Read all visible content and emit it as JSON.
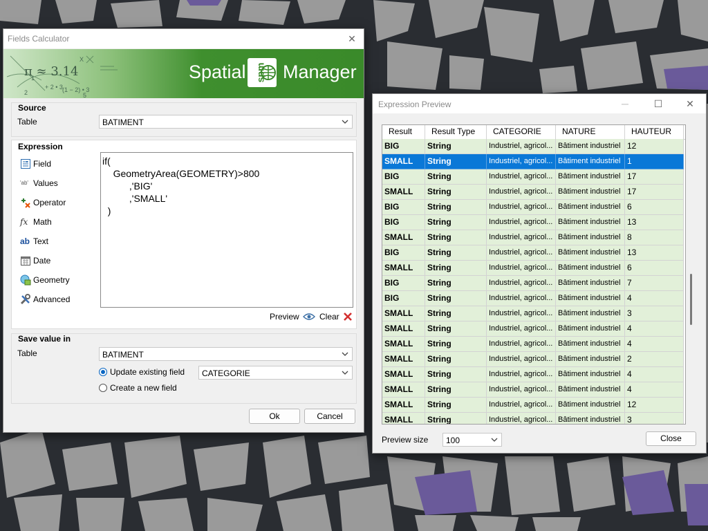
{
  "colors": {
    "accent": "#0a78d7",
    "row_green": "#e2f0d9",
    "banner_green": "#3f8f2e",
    "map_bg": "#2a2d32",
    "building_gray": "#9a9a9a",
    "building_purple": "#6a5a9a"
  },
  "fields_calculator": {
    "title": "Fields Calculator",
    "banner": {
      "formula": "π ≈ 3.14",
      "brand_left": "Spatial",
      "brand_badge": "spm",
      "brand_right": "Manager"
    },
    "source": {
      "title": "Source",
      "table_label": "Table",
      "table_value": "BATIMENT"
    },
    "expression": {
      "title": "Expression",
      "categories": [
        {
          "label": "Field",
          "icon": "field-icon"
        },
        {
          "label": "Values",
          "icon": "values-icon",
          "badge": "'ab'"
        },
        {
          "label": "Operator",
          "icon": "operator-icon"
        },
        {
          "label": "Math",
          "icon": "math-icon",
          "badge": "fx"
        },
        {
          "label": "Text",
          "icon": "text-icon",
          "badge": "ab"
        },
        {
          "label": "Date",
          "icon": "date-icon"
        },
        {
          "label": "Geometry",
          "icon": "geometry-icon"
        },
        {
          "label": "Advanced",
          "icon": "advanced-icon"
        }
      ],
      "code": "if(\n    GeometryArea(GEOMETRY)>800\n          ,'BIG'\n          ,'SMALL'\n  )",
      "preview_label": "Preview",
      "clear_label": "Clear"
    },
    "save": {
      "title": "Save value in",
      "table_label": "Table",
      "table_value": "BATIMENT",
      "update_label": "Update existing field",
      "update_field_value": "CATEGORIE",
      "create_label": "Create a new field",
      "selected_option": "update"
    },
    "ok_label": "Ok",
    "cancel_label": "Cancel"
  },
  "expression_preview": {
    "title": "Expression Preview",
    "columns": [
      "Result",
      "Result Type",
      "CATEGORIE",
      "NATURE",
      "HAUTEUR"
    ],
    "rows": [
      [
        "BIG",
        "String",
        "Industriel, agricol...",
        "Bâtiment industriel",
        "12"
      ],
      [
        "SMALL",
        "String",
        "Industriel, agricol...",
        "Bâtiment industriel",
        "1"
      ],
      [
        "BIG",
        "String",
        "Industriel, agricol...",
        "Bâtiment industriel",
        "17"
      ],
      [
        "SMALL",
        "String",
        "Industriel, agricol...",
        "Bâtiment industriel",
        "17"
      ],
      [
        "BIG",
        "String",
        "Industriel, agricol...",
        "Bâtiment industriel",
        "6"
      ],
      [
        "BIG",
        "String",
        "Industriel, agricol...",
        "Bâtiment industriel",
        "13"
      ],
      [
        "SMALL",
        "String",
        "Industriel, agricol...",
        "Bâtiment industriel",
        "8"
      ],
      [
        "BIG",
        "String",
        "Industriel, agricol...",
        "Bâtiment industriel",
        "13"
      ],
      [
        "SMALL",
        "String",
        "Industriel, agricol...",
        "Bâtiment industriel",
        "6"
      ],
      [
        "BIG",
        "String",
        "Industriel, agricol...",
        "Bâtiment industriel",
        "7"
      ],
      [
        "BIG",
        "String",
        "Industriel, agricol...",
        "Bâtiment industriel",
        "4"
      ],
      [
        "SMALL",
        "String",
        "Industriel, agricol...",
        "Bâtiment industriel",
        "3"
      ],
      [
        "SMALL",
        "String",
        "Industriel, agricol...",
        "Bâtiment industriel",
        "4"
      ],
      [
        "SMALL",
        "String",
        "Industriel, agricol...",
        "Bâtiment industriel",
        "4"
      ],
      [
        "SMALL",
        "String",
        "Industriel, agricol...",
        "Bâtiment industriel",
        "2"
      ],
      [
        "SMALL",
        "String",
        "Industriel, agricol...",
        "Bâtiment industriel",
        "4"
      ],
      [
        "SMALL",
        "String",
        "Industriel, agricol...",
        "Bâtiment industriel",
        "4"
      ],
      [
        "SMALL",
        "String",
        "Industriel, agricol...",
        "Bâtiment industriel",
        "12"
      ],
      [
        "SMALL",
        "String",
        "Industriel, agricol...",
        "Bâtiment industriel",
        "3"
      ]
    ],
    "selected_row": 1,
    "preview_size_label": "Preview size",
    "preview_size_value": "100",
    "close_label": "Close"
  }
}
